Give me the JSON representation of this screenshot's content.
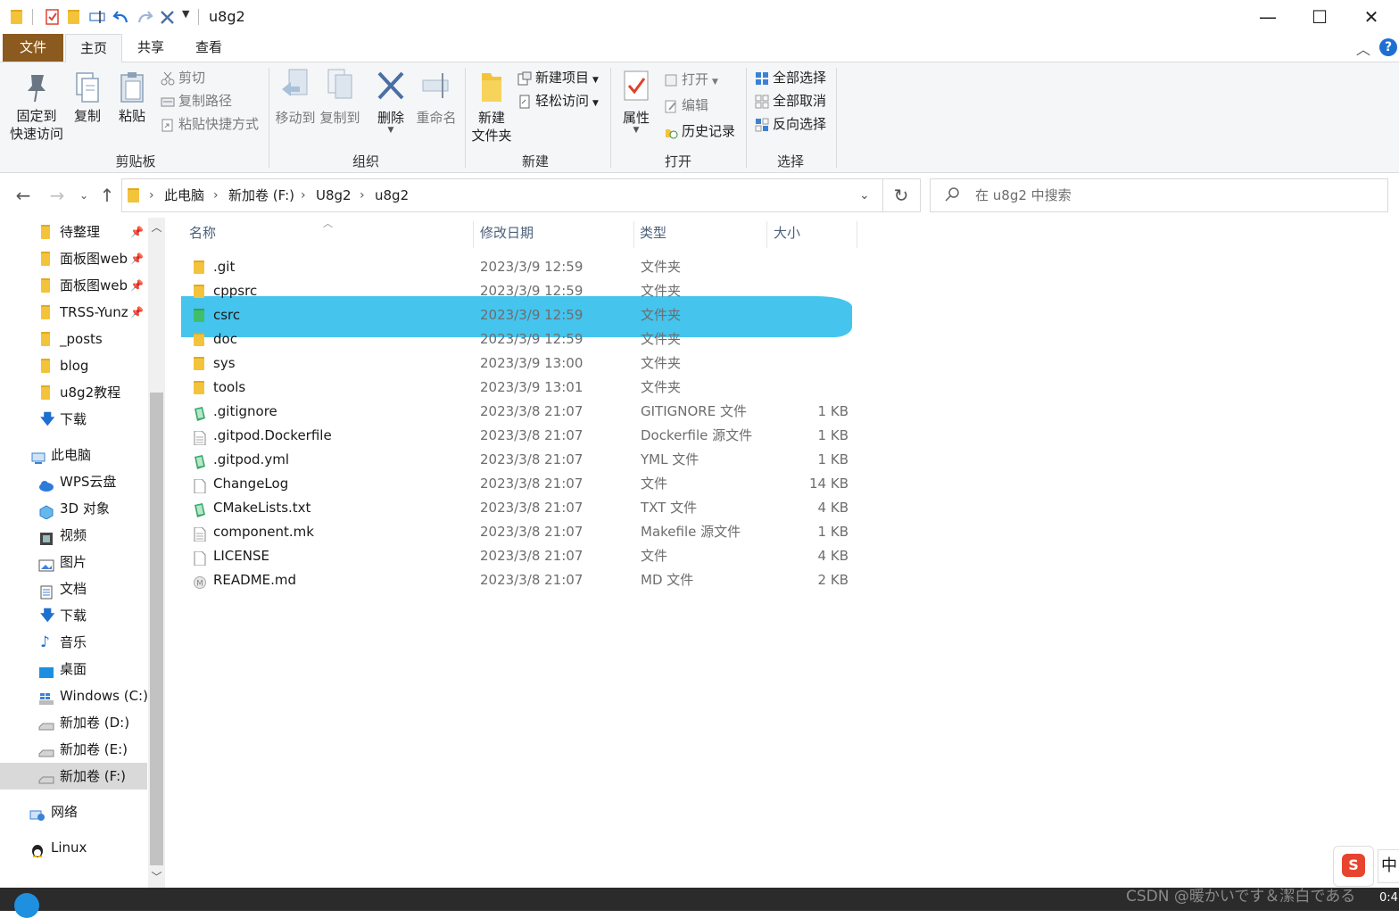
{
  "window": {
    "title": "u8g2",
    "controls": {
      "minimize": "—",
      "maximize": "☐",
      "close": "✕"
    }
  },
  "ribbon": {
    "tabs": [
      "文件",
      "主页",
      "共享",
      "查看"
    ],
    "active_tab": "主页",
    "groups": {
      "clipboard": {
        "label": "剪贴板",
        "pin_quick_access_1": "固定到",
        "pin_quick_access_2": "快速访问",
        "copy": "复制",
        "paste": "粘贴",
        "cut": "剪切",
        "copy_path": "复制路径",
        "paste_shortcut": "粘贴快捷方式"
      },
      "organize": {
        "label": "组织",
        "move_to": "移动到",
        "copy_to": "复制到",
        "delete": "删除",
        "rename": "重命名"
      },
      "new": {
        "label": "新建",
        "new_folder_1": "新建",
        "new_folder_2": "文件夹",
        "new_item": "新建项目",
        "easy_access": "轻松访问"
      },
      "open": {
        "label": "打开",
        "properties": "属性",
        "open": "打开",
        "edit": "编辑",
        "history": "历史记录"
      },
      "select": {
        "label": "选择",
        "select_all": "全部选择",
        "select_none": "全部取消",
        "invert_selection": "反向选择"
      }
    }
  },
  "address": {
    "breadcrumb": [
      "此电脑",
      "新加卷 (F:)",
      "U8g2",
      "u8g2"
    ],
    "search_placeholder": "在 u8g2 中搜索"
  },
  "nav": {
    "quick_access": [
      {
        "label": "待整理",
        "icon": "folder-icon",
        "pinned": true
      },
      {
        "label": "面板图web",
        "icon": "folder-icon",
        "pinned": true
      },
      {
        "label": "面板图web",
        "icon": "folder-icon",
        "pinned": true
      },
      {
        "label": "TRSS-Yunz",
        "icon": "folder-icon",
        "pinned": true
      },
      {
        "label": "_posts",
        "icon": "folder-icon",
        "pinned": false
      },
      {
        "label": "blog",
        "icon": "folder-icon",
        "pinned": false
      },
      {
        "label": "u8g2教程",
        "icon": "folder-icon",
        "pinned": false
      },
      {
        "label": "下载",
        "icon": "download-icon",
        "pinned": false
      }
    ],
    "this_pc": "此电脑",
    "pc_items": [
      {
        "label": "WPS云盘",
        "icon": "cloud-icon"
      },
      {
        "label": "3D 对象",
        "icon": "cube-icon"
      },
      {
        "label": "视频",
        "icon": "video-icon"
      },
      {
        "label": "图片",
        "icon": "picture-icon"
      },
      {
        "label": "文档",
        "icon": "document-icon"
      },
      {
        "label": "下载",
        "icon": "download-icon"
      },
      {
        "label": "音乐",
        "icon": "music-icon"
      },
      {
        "label": "桌面",
        "icon": "desktop-icon"
      },
      {
        "label": "Windows (C:)",
        "icon": "windows-drive-icon"
      },
      {
        "label": "新加卷 (D:)",
        "icon": "drive-icon"
      },
      {
        "label": "新加卷 (E:)",
        "icon": "drive-icon"
      },
      {
        "label": "新加卷 (F:)",
        "icon": "drive-icon",
        "selected": true
      }
    ],
    "network": "网络",
    "linux": "Linux"
  },
  "list": {
    "columns": {
      "name": "名称",
      "date": "修改日期",
      "type": "类型",
      "size": "大小"
    },
    "rows": [
      {
        "name": ".git",
        "date": "2023/3/9 12:59",
        "type": "文件夹",
        "size": "",
        "icon": "folder-icon"
      },
      {
        "name": "cppsrc",
        "date": "2023/3/9 12:59",
        "type": "文件夹",
        "size": "",
        "icon": "folder-icon"
      },
      {
        "name": "csrc",
        "date": "2023/3/9 12:59",
        "type": "文件夹",
        "size": "",
        "icon": "folder-icon",
        "highlighted": true
      },
      {
        "name": "doc",
        "date": "2023/3/9 12:59",
        "type": "文件夹",
        "size": "",
        "icon": "folder-icon"
      },
      {
        "name": "sys",
        "date": "2023/3/9 13:00",
        "type": "文件夹",
        "size": "",
        "icon": "folder-icon"
      },
      {
        "name": "tools",
        "date": "2023/3/9 13:01",
        "type": "文件夹",
        "size": "",
        "icon": "folder-icon"
      },
      {
        "name": ".gitignore",
        "date": "2023/3/8 21:07",
        "type": "GITIGNORE 文件",
        "size": "1 KB",
        "icon": "green-file-icon"
      },
      {
        "name": ".gitpod.Dockerfile",
        "date": "2023/3/8 21:07",
        "type": "Dockerfile 源文件",
        "size": "1 KB",
        "icon": "text-file-icon"
      },
      {
        "name": ".gitpod.yml",
        "date": "2023/3/8 21:07",
        "type": "YML 文件",
        "size": "1 KB",
        "icon": "green-file-icon"
      },
      {
        "name": "ChangeLog",
        "date": "2023/3/8 21:07",
        "type": "文件",
        "size": "14 KB",
        "icon": "blank-file-icon"
      },
      {
        "name": "CMakeLists.txt",
        "date": "2023/3/8 21:07",
        "type": "TXT 文件",
        "size": "4 KB",
        "icon": "green-file-icon"
      },
      {
        "name": "component.mk",
        "date": "2023/3/8 21:07",
        "type": "Makefile 源文件",
        "size": "1 KB",
        "icon": "text-file-icon"
      },
      {
        "name": "LICENSE",
        "date": "2023/3/8 21:07",
        "type": "文件",
        "size": "4 KB",
        "icon": "blank-file-icon"
      },
      {
        "name": "README.md",
        "date": "2023/3/8 21:07",
        "type": "MD 文件",
        "size": "2 KB",
        "icon": "markdown-file-icon"
      }
    ]
  },
  "overlay": {
    "watermark": "CSDN @暖かいです＆潔白である",
    "ime_label": "中",
    "clock_fragment": "0:4"
  },
  "colors": {
    "file_tab": "#8a5a1e",
    "highlight": "#45c4ee",
    "folder": "#f3c33b",
    "accent": "#1e6fd0"
  }
}
